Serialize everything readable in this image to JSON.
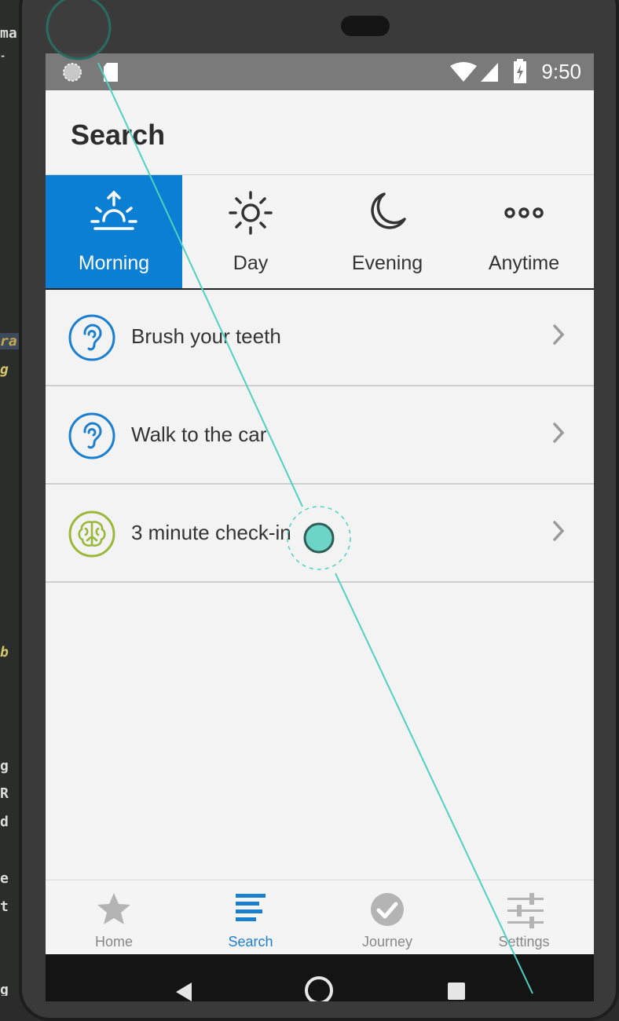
{
  "ide_fragments": [
    "ma",
    "-",
    "ra",
    "g",
    "b",
    "g",
    "R",
    "d",
    "e",
    "t",
    "g"
  ],
  "status_bar": {
    "time": "9:50"
  },
  "app_bar": {
    "title": "Search"
  },
  "tabs": [
    {
      "label": "Morning",
      "icon": "sunrise-icon",
      "active": true
    },
    {
      "label": "Day",
      "icon": "sun-icon",
      "active": false
    },
    {
      "label": "Evening",
      "icon": "moon-icon",
      "active": false
    },
    {
      "label": "Anytime",
      "icon": "dots-icon",
      "active": false
    }
  ],
  "list_items": [
    {
      "label": "Brush your teeth",
      "icon": "ear-icon",
      "icon_color": "#1b7fcf"
    },
    {
      "label": "Walk to the car",
      "icon": "ear-icon",
      "icon_color": "#1b7fcf"
    },
    {
      "label": "3 minute check-in",
      "icon": "brain-icon",
      "icon_color": "#9ab93a"
    }
  ],
  "bottom_nav": [
    {
      "label": "Home",
      "icon": "star-icon",
      "active": false
    },
    {
      "label": "Search",
      "icon": "search-lines-icon",
      "active": true
    },
    {
      "label": "Journey",
      "icon": "check-circle-icon",
      "active": false
    },
    {
      "label": "Settings",
      "icon": "sliders-icon",
      "active": false
    }
  ],
  "colors": {
    "accent": "#0a7fd3",
    "status_bar": "#7a7a7a",
    "background": "#f3f3f3",
    "gesture_trace": "#4fd1c0"
  }
}
